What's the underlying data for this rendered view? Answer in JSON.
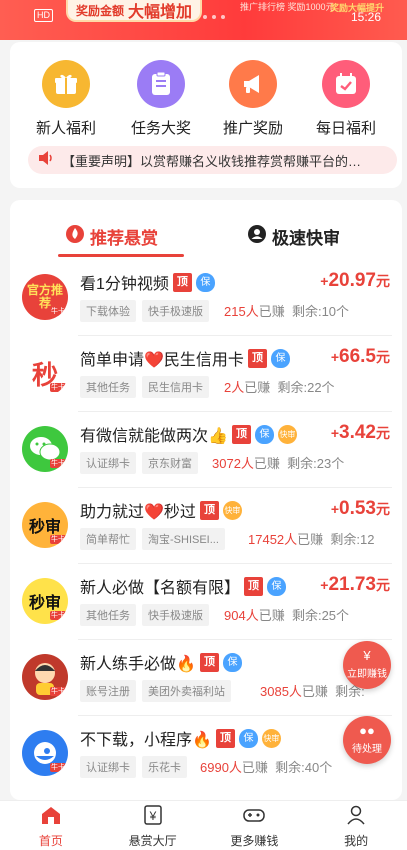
{
  "banner": {
    "hd": "HD",
    "pill_a": "奖励金额",
    "pill_b": "大幅增加",
    "promo_small": "推广排行榜 奖励1000元",
    "promo_hot": "奖励大幅提升",
    "time": "15:26"
  },
  "quick_menu": [
    {
      "label": "新人福利",
      "icon": "gift-icon",
      "color": "#f7b731"
    },
    {
      "label": "任务大奖",
      "icon": "list-icon",
      "color": "#9b7cf5"
    },
    {
      "label": "推广奖励",
      "icon": "megaphone-icon",
      "color": "#ff7a4a"
    },
    {
      "label": "每日福利",
      "icon": "calendar-icon",
      "color": "#ff5d7a"
    }
  ],
  "notice": {
    "text": "【重要声明】以赏帮赚名义收钱推荐赏帮赚平台的…"
  },
  "tabs": {
    "recommend": "推荐悬赏",
    "fast": "极速快审"
  },
  "tasks": [
    {
      "title": "看1分钟视频",
      "chips": [
        "下载体验",
        "快手极速版"
      ],
      "count": "215人",
      "done": "已赚",
      "remain": "剩余:10个",
      "reward": "20.97",
      "currency": "元",
      "tags": [
        "顶",
        "保"
      ],
      "avatar_text": "官方推荐",
      "avatar_bg": "#e8423a"
    },
    {
      "title": "简单申请❤️民生信用卡",
      "chips": [
        "其他任务",
        "民生信用卡"
      ],
      "count": "2人",
      "done": "已赚",
      "remain": "剩余:22个",
      "reward": "66.5",
      "currency": "元",
      "tags": [
        "顶",
        "保"
      ],
      "avatar_text": "秒",
      "avatar_bg": "#ffffff"
    },
    {
      "title": "有微信就能做两次👍",
      "chips": [
        "认证绑卡",
        "京东财富"
      ],
      "count": "3072人",
      "done": "已赚",
      "remain": "剩余:23个",
      "reward": "3.42",
      "currency": "元",
      "tags": [
        "顶",
        "保",
        "快审"
      ],
      "avatar_text": "",
      "avatar_bg": "#3ec83e"
    },
    {
      "title": "助力就过❤️秒过",
      "chips": [
        "简单帮忙",
        "淘宝-SHISEI..."
      ],
      "count": "17452人",
      "done": "已赚",
      "remain": "剩余:12",
      "reward": "0.53",
      "currency": "元",
      "tags": [
        "顶",
        "快审"
      ],
      "avatar_text": "秒审",
      "avatar_bg": "#ffb33a"
    },
    {
      "title": "新人必做【名额有限】",
      "chips": [
        "其他任务",
        "快手极速版"
      ],
      "count": "904人",
      "done": "已赚",
      "remain": "剩余:25个",
      "reward": "21.73",
      "currency": "元",
      "tags": [
        "顶",
        "保"
      ],
      "avatar_text": "秒审",
      "avatar_bg": "#ffe24a"
    },
    {
      "title": "新人练手必做🔥",
      "chips": [
        "账号注册",
        "美团外卖福利站"
      ],
      "count": "3085人",
      "done": "已赚",
      "remain": "剩余:",
      "reward": "",
      "currency": "",
      "tags": [
        "顶",
        "保"
      ],
      "avatar_text": "",
      "avatar_bg": "#c0392b"
    },
    {
      "title": "不下载，小程序🔥",
      "chips": [
        "认证绑卡",
        "乐花卡"
      ],
      "count": "6990人",
      "done": "已赚",
      "remain": "剩余:40个",
      "reward": "",
      "currency": "",
      "tags": [
        "顶",
        "保",
        "快审"
      ],
      "avatar_text": "",
      "avatar_bg": "#2e7df0"
    }
  ],
  "floats": {
    "earn": "立即赚钱",
    "pending": "待处理"
  },
  "bottom_nav": [
    {
      "label": "首页",
      "active": true
    },
    {
      "label": "悬赏大厅",
      "active": false
    },
    {
      "label": "更多赚钱",
      "active": false
    },
    {
      "label": "我的",
      "active": false
    }
  ]
}
